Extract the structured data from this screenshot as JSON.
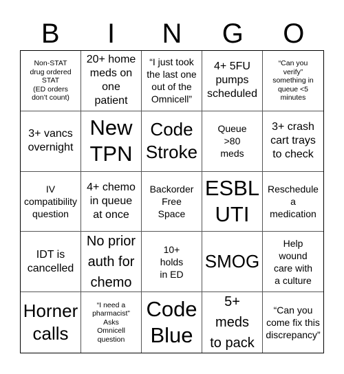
{
  "header": {
    "letters": [
      "B",
      "I",
      "N",
      "G",
      "O"
    ]
  },
  "cells": [
    {
      "text": "Non-STAT\ndrug ordered\nSTAT\n(ED orders\ndon’t count)",
      "size": "s-xs"
    },
    {
      "text": "20+ home\nmeds on\none\npatient",
      "size": "s-md"
    },
    {
      "text": "“I just took\nthe last one\nout of the\nOmnicell”",
      "size": "s-sm"
    },
    {
      "text": "4+ 5FU\npumps\nscheduled",
      "size": "s-md"
    },
    {
      "text": "“Can you\nverify”\nsomething in\nqueue <5\nminutes",
      "size": "s-xs"
    },
    {
      "text": "3+ vancs\novernight",
      "size": "s-md"
    },
    {
      "text": "New\nTPN",
      "size": "s-xxl"
    },
    {
      "text": "Code\nStroke",
      "size": "s-xl"
    },
    {
      "text": "Queue\n>80\nmeds",
      "size": "s-sm"
    },
    {
      "text": "3+ crash\ncart trays\nto check",
      "size": "s-md"
    },
    {
      "text": "IV\ncompatibility\nquestion",
      "size": "s-sm"
    },
    {
      "text": "4+ chemo\nin queue\nat once",
      "size": "s-md"
    },
    {
      "text": "Backorder\nFree\nSpace",
      "size": "s-sm"
    },
    {
      "text": "ESBL\nUTI",
      "size": "s-xxl"
    },
    {
      "text": "Reschedule\na\nmedication",
      "size": "s-sm"
    },
    {
      "text": "IDT is\ncancelled",
      "size": "s-md"
    },
    {
      "text": "No prior\nauth for\nchemo",
      "size": "s-lg"
    },
    {
      "text": "10+\nholds\nin ED",
      "size": "s-sm"
    },
    {
      "text": "SMOG",
      "size": "s-xl"
    },
    {
      "text": "Help\nwound\ncare with\na culture",
      "size": "s-sm"
    },
    {
      "text": "Horner\ncalls",
      "size": "s-xl"
    },
    {
      "text": "“I need a\npharmacist”\nAsks\nOmnicell\nquestion",
      "size": "s-xs"
    },
    {
      "text": "Code\nBlue",
      "size": "s-xxl"
    },
    {
      "text": "5+\nmeds\nto pack",
      "size": "s-lg"
    },
    {
      "text": "“Can you\ncome fix this\ndiscrepancy”",
      "size": "s-sm"
    }
  ]
}
